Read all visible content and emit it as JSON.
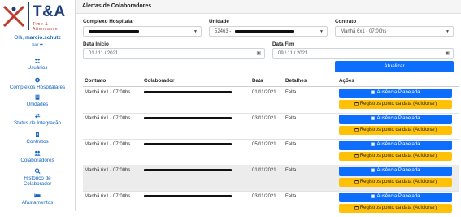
{
  "app": {
    "logo_title": "T&A",
    "logo_subtitle": "Time & Attendance",
    "brand_colors": {
      "primary": "#1f3f7a",
      "accent": "#c0392b",
      "link": "#1565c0"
    }
  },
  "user": {
    "greeting": "Olá,",
    "username": "marcio.schutz",
    "logout_label": "Sair"
  },
  "sidebar": {
    "items": [
      {
        "label": "Usuários",
        "icon": "users-icon"
      },
      {
        "label": "Complexos Hospitalares",
        "icon": "hospital-icon"
      },
      {
        "label": "Unidades",
        "icon": "building-icon"
      },
      {
        "label": "Status de Integração",
        "icon": "exchange-icon"
      },
      {
        "label": "Contratos",
        "icon": "contract-icon"
      },
      {
        "label": "Colaboradores",
        "icon": "users-icon"
      },
      {
        "label": "Histórico de",
        "label2": "Colaborador",
        "icon": "history-icon"
      },
      {
        "label": "Afastamentos",
        "icon": "bed-icon"
      }
    ]
  },
  "panel": {
    "title": "Alertas de Colaboradores"
  },
  "filters": {
    "complexo": {
      "label": "Complexo Hospitalar",
      "value": ""
    },
    "unidade": {
      "label": "Unidade",
      "value_prefix": "52463 -"
    },
    "contrato": {
      "label": "Contrato",
      "value": "Manhã 6x1 - 07:00hs"
    },
    "data_inicio": {
      "label": "Data Inicio",
      "value": "01 / 11 / 2021"
    },
    "data_fim": {
      "label": "Data Fim",
      "value": "09 / 11 / 2021"
    },
    "update_button": "Atualizar"
  },
  "table": {
    "headers": {
      "contrato": "Contrato",
      "colaborador": "Colaborador",
      "data": "Data",
      "detalhes": "Detalhes",
      "acoes": "Ações"
    },
    "actions": {
      "planned_absence": "Ausência Planejada",
      "clock_records": "Registros ponto da data (Adicionar)"
    },
    "rows": [
      {
        "contrato": "Manhã 6x1 - 07:00hs",
        "data": "01/11/2021",
        "detalhes": "Falta"
      },
      {
        "contrato": "Manhã 6x1 - 07:00hs",
        "data": "03/11/2021",
        "detalhes": "Falta"
      },
      {
        "contrato": "Manhã 6x1 - 07:00hs",
        "data": "05/11/2021",
        "detalhes": "Falta"
      },
      {
        "contrato": "Manhã 6x1 - 07:00hs",
        "data": "01/11/2021",
        "detalhes": "Falta"
      },
      {
        "contrato": "Manhã 6x1 - 07:00hs",
        "data": "03/11/2021",
        "detalhes": "Falta"
      }
    ]
  }
}
